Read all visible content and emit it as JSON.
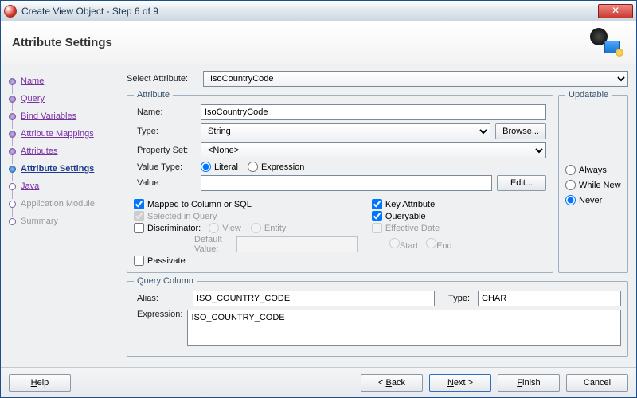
{
  "window": {
    "title": "Create View Object - Step 6 of 9"
  },
  "banner": {
    "heading": "Attribute Settings"
  },
  "sidebar": {
    "items": [
      {
        "label": "Name"
      },
      {
        "label": "Query"
      },
      {
        "label": "Bind Variables"
      },
      {
        "label": "Attribute Mappings"
      },
      {
        "label": "Attributes"
      },
      {
        "label": "Attribute Settings"
      },
      {
        "label": "Java"
      },
      {
        "label": "Application Module"
      },
      {
        "label": "Summary"
      }
    ]
  },
  "selectAttr": {
    "label": "Select Attribute:",
    "value": "IsoCountryCode"
  },
  "attribute": {
    "legend": "Attribute",
    "name_label": "Name:",
    "name_value": "IsoCountryCode",
    "type_label": "Type:",
    "type_value": "String",
    "browse_label": "Browse...",
    "propset_label": "Property Set:",
    "propset_value": "<None>",
    "valtype_label": "Value Type:",
    "valtype_literal": "Literal",
    "valtype_expression": "Expression",
    "value_label": "Value:",
    "value_value": "",
    "edit_label": "Edit...",
    "chk_mapped": "Mapped to Column or SQL",
    "chk_selected": "Selected in Query",
    "chk_discrim": "Discriminator:",
    "discrim_view": "View",
    "discrim_entity": "Entity",
    "defval_label": "Default Value:",
    "chk_passivate": "Passivate",
    "chk_keyattr": "Key Attribute",
    "chk_queryable": "Queryable",
    "chk_effdate": "Effective Date",
    "eff_start": "Start",
    "eff_end": "End"
  },
  "updatable": {
    "legend": "Updatable",
    "always": "Always",
    "whilenew": "While New",
    "never": "Never"
  },
  "queryCol": {
    "legend": "Query Column",
    "alias_label": "Alias:",
    "alias_value": "ISO_COUNTRY_CODE",
    "type_label": "Type:",
    "type_value": "CHAR",
    "expr_label": "Expression:",
    "expr_value": "ISO_COUNTRY_CODE"
  },
  "footer": {
    "help": "Help",
    "back": "< Back",
    "next": "Next >",
    "finish": "Finish",
    "cancel": "Cancel"
  }
}
